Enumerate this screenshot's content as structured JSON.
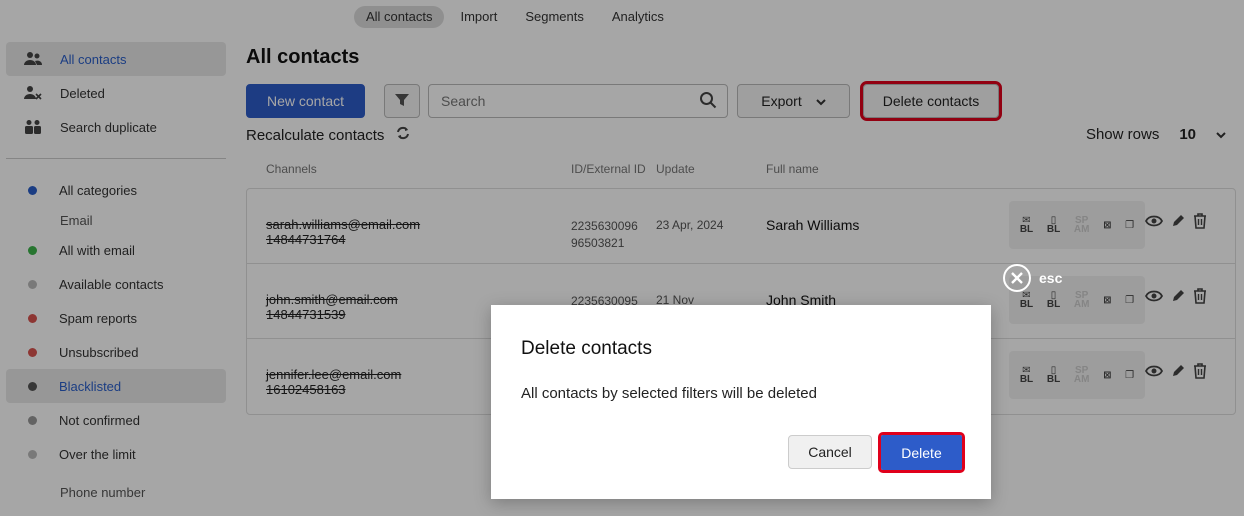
{
  "topnav": {
    "tabs": [
      {
        "label": "All contacts",
        "active": true
      },
      {
        "label": "Import"
      },
      {
        "label": "Segments"
      },
      {
        "label": "Analytics"
      }
    ]
  },
  "sidebar": {
    "items": [
      {
        "label": "All contacts",
        "icon": "people-icon",
        "active": true
      },
      {
        "label": "Deleted",
        "icon": "person-remove-icon"
      },
      {
        "label": "Search duplicate",
        "icon": "duplicate-people-icon"
      }
    ],
    "categories": [
      {
        "label": "All categories",
        "color": "#2a5fc9"
      },
      {
        "label": "Email",
        "subheader": true
      },
      {
        "label": "All with email",
        "color": "#3cb44b"
      },
      {
        "label": "Available contacts",
        "color": "#bbbbbb"
      },
      {
        "label": "Spam reports",
        "color": "#d9534f"
      },
      {
        "label": "Unsubscribed",
        "color": "#d9534f"
      },
      {
        "label": "Blacklisted",
        "color": "#555555",
        "active": true
      },
      {
        "label": "Not confirmed",
        "color": "#999999"
      },
      {
        "label": "Over the limit",
        "color": "#bbbbbb"
      },
      {
        "label": "Phone number",
        "subheader": true
      }
    ]
  },
  "main": {
    "title": "All contacts",
    "new_contact": "New contact",
    "search_placeholder": "Search",
    "export": "Export",
    "delete_contacts": "Delete contacts",
    "recalculate": "Recalculate contacts",
    "show_rows_label": "Show rows",
    "show_rows_value": "10"
  },
  "table": {
    "headers": {
      "channels": "Channels",
      "id": "ID/External ID",
      "update": "Update",
      "name": "Full name"
    },
    "rows": [
      {
        "email": "sarah.williams@email.com",
        "phone": "14844731764",
        "id": "2235630096",
        "ext_id": "96503821",
        "update": "23 Apr, 2024",
        "name": "Sarah Williams"
      },
      {
        "email": "john.smith@email.com",
        "phone": "14844731539",
        "id": "2235630095",
        "ext_id": "",
        "update": "21 Nov",
        "name": "John Smith"
      },
      {
        "email": "jennifer.lee@email.com",
        "phone": "16102458163",
        "id": "",
        "ext_id": "",
        "update": "",
        "name": ""
      }
    ],
    "action_labels": {
      "bl": "BL",
      "sp": "SP",
      "am": "AM"
    }
  },
  "overlay": {
    "esc": "esc"
  },
  "modal": {
    "title": "Delete contacts",
    "text": "All contacts by selected filters will be deleted",
    "cancel": "Cancel",
    "delete": "Delete"
  },
  "colors": {
    "accent": "#2d5cc9",
    "highlight": "#e0001b"
  }
}
